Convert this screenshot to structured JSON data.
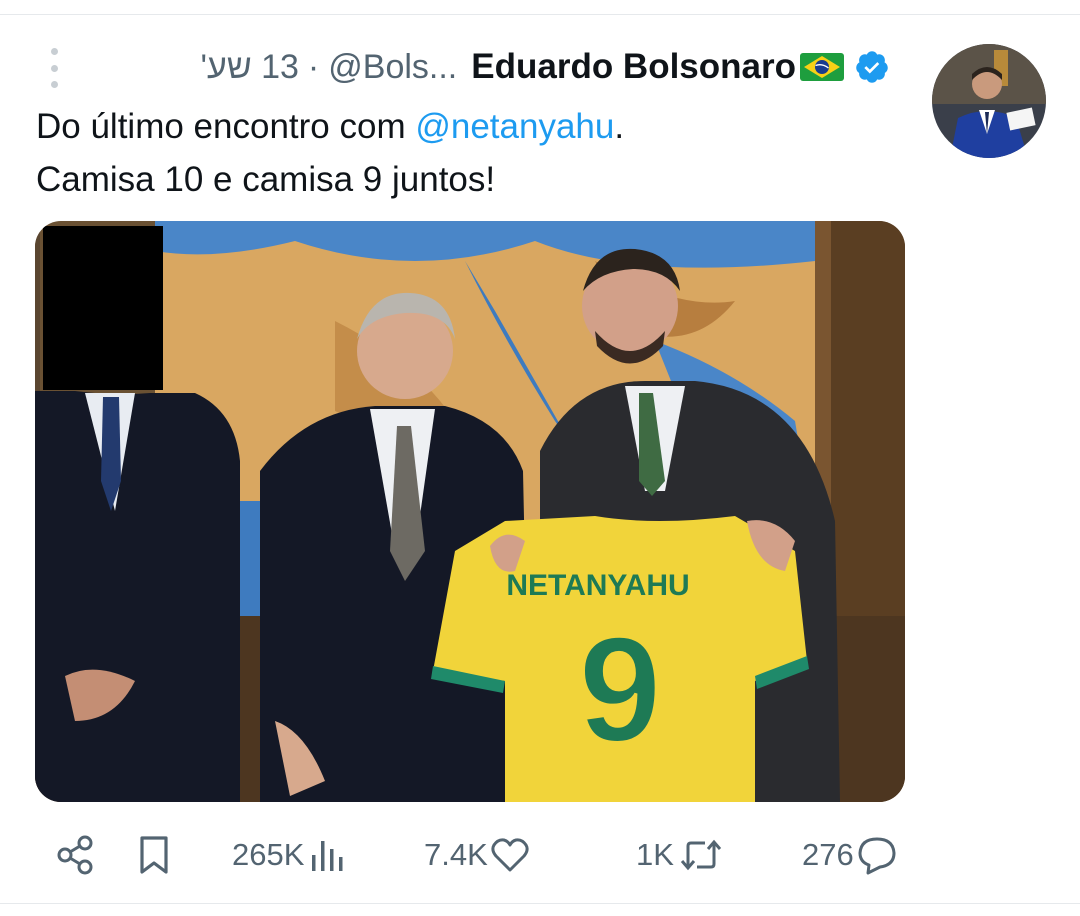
{
  "tweet": {
    "time": "13 שע'",
    "separator": "·",
    "handle": "@Bols...",
    "author_name": "Eduardo Bolsonaro",
    "flag_icon": "brazil-flag-icon",
    "verified_icon": "verified-badge-icon",
    "text": {
      "line1_before": "Do último encontro com ",
      "mention": "@netanyahu",
      "line1_after": ".",
      "line2": "Camisa 10 e camisa 9 juntos!"
    },
    "media": {
      "jersey_name": "NETANYAHU",
      "jersey_number": "9"
    }
  },
  "actions": {
    "views": "265K",
    "likes": "7.4K",
    "reposts": "1K",
    "replies": "276"
  },
  "colors": {
    "accent": "#1d9bf0",
    "muted": "#536471",
    "text": "#0f1419"
  }
}
